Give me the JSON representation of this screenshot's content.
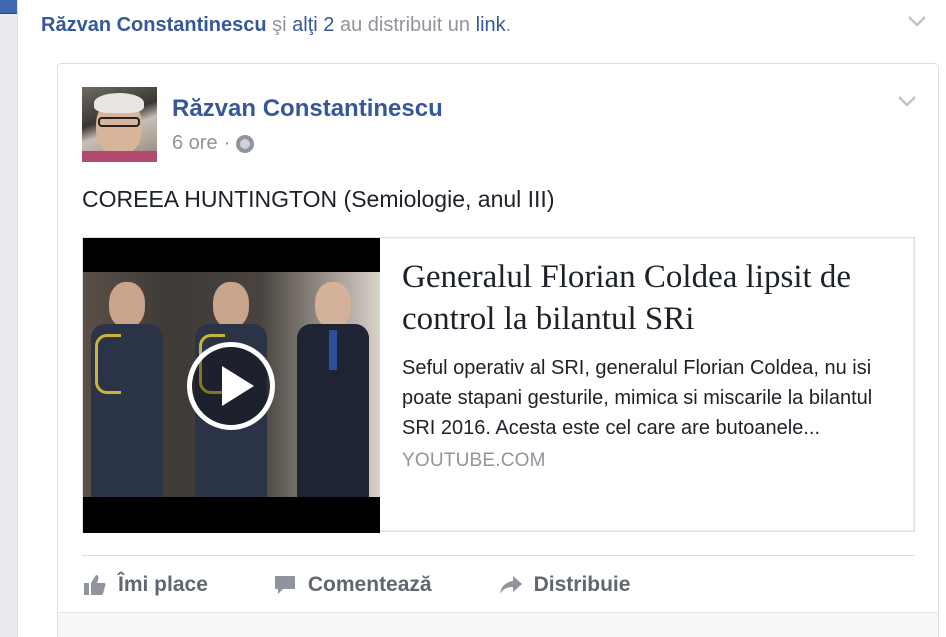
{
  "share_notice": {
    "sharer": "Răzvan Constantinescu",
    "connector": " şi ",
    "others": "alţi 2",
    "verb": " au distribuit un ",
    "object": "link",
    "period": "."
  },
  "post": {
    "author": "Răzvan Constantinescu",
    "time": "6 ore",
    "separator": "·",
    "privacy_icon": "globe-icon",
    "text": "COREEA HUNTINGTON (Semiologie, anul III)"
  },
  "link_preview": {
    "title": "Generalul Florian Coldea lipsit de control la bilantul SRi",
    "description": "Seful operativ al SRI, generalul Florian Coldea, nu isi poate stapani gesturile, mimica si miscarile la bilantul SRI 2016. Acesta este cel care are butoanele...",
    "domain": "YOUTUBE.COM",
    "media_icon": "play-icon"
  },
  "actions": {
    "like": "Îmi place",
    "comment": "Comentează",
    "share": "Distribuie"
  },
  "colors": {
    "brand_blue": "#4267b2",
    "link_blue": "#365899",
    "meta_gray": "#90949c",
    "action_gray": "#616770",
    "text_dark": "#1d2129"
  }
}
